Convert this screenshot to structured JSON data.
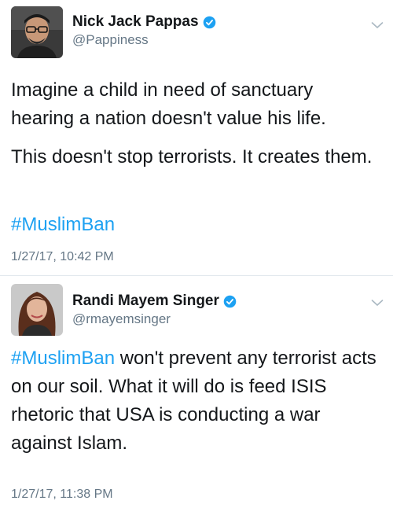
{
  "tweets": [
    {
      "display_name": "Nick Jack Pappas",
      "handle": "@Pappiness",
      "verified": true,
      "paragraphs": [
        "Imagine a child in need of sanctuary hearing a nation doesn't value his life.",
        "This doesn't stop terrorists. It creates them."
      ],
      "hashtag": "#MuslimBan",
      "timestamp": "1/27/17, 10:42 PM"
    },
    {
      "display_name": "Randi Mayem Singer",
      "handle": "@rmayemsinger",
      "verified": true,
      "hashtag": "#MuslimBan",
      "body": " won't prevent any terrorist acts on our soil. What it will do is feed ISIS rhetoric that USA is conducting a war against Islam.",
      "timestamp": "1/27/17, 11:38 PM"
    }
  ],
  "colors": {
    "link": "#1da1f2",
    "verified": "#1da1f2",
    "secondary_text": "#657786",
    "divider": "#e1e8ed"
  },
  "icons": [
    "verified-badge-icon",
    "chevron-down-icon"
  ]
}
